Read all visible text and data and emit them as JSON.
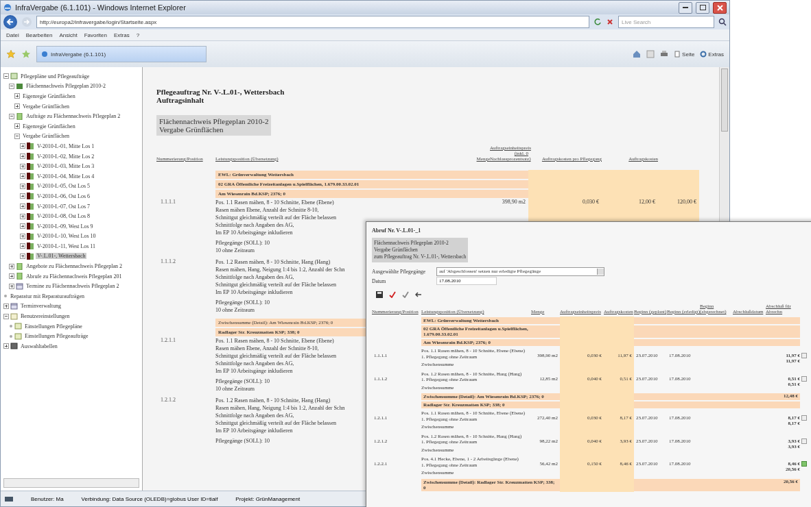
{
  "window": {
    "title": "InfraVergabe (6.1.101) - Windows Internet Explorer"
  },
  "address_bar": {
    "url": "http://europa2/infravergabe/login/Startseite.aspx",
    "search_placeholder": "Live Search"
  },
  "menu": [
    "Datei",
    "Bearbeiten",
    "Ansicht",
    "Favoriten",
    "Extras",
    "?"
  ],
  "tab": {
    "label": "InfraVergabe (6.1.101)",
    "selected": true
  },
  "command_bar": [
    "Seite",
    "Extras"
  ],
  "tree": [
    {
      "label": "Pflegepläne und Pflegeaufträge",
      "kind": "folder",
      "expanded": true,
      "children": [
        {
          "label": "Flächennachweis Pflegeplan 2010-2",
          "kind": "plan",
          "expanded": true,
          "children": [
            {
              "label": "Eigenregie Grünflächen",
              "expanded": false
            },
            {
              "label": "Vergabe Grünflächen",
              "expanded": false
            }
          ]
        },
        {
          "label": "Aufträge zu Flächennachweis Pflegeplan 2",
          "kind": "doc",
          "expanded": true,
          "children": [
            {
              "label": "Eigenregie Grünflächen",
              "expanded": false
            },
            {
              "label": "Vergabe Grünflächen",
              "expanded": true,
              "children": [
                {
                  "label": "V-2010-L-01, Mitte Los 1",
                  "kind": "lot",
                  "expanded": false,
                  "selected": false
                },
                {
                  "label": "V-2010-L-02, Mitte Los 2",
                  "kind": "lot",
                  "expanded": false,
                  "selected": false
                },
                {
                  "label": "V-2010-L-03, Mitte Los 3",
                  "kind": "lot",
                  "expanded": false,
                  "selected": false
                },
                {
                  "label": "V-2010-L-04, Mitte Los 4",
                  "kind": "lot",
                  "expanded": false,
                  "selected": false
                },
                {
                  "label": "V-2010-L-05, Ost Los 5",
                  "kind": "lot",
                  "expanded": false,
                  "selected": false
                },
                {
                  "label": "V-2010-L-06, Ost Los 6",
                  "kind": "lot",
                  "expanded": false,
                  "selected": false
                },
                {
                  "label": "V-2010-L-07, Ost Los 7",
                  "kind": "lot",
                  "expanded": false,
                  "selected": false
                },
                {
                  "label": "V-2010-L-08, Ost Los 8",
                  "kind": "lot",
                  "expanded": false,
                  "selected": false
                },
                {
                  "label": "V-2010-L-09, West Los 9",
                  "kind": "lot",
                  "expanded": false,
                  "selected": false
                },
                {
                  "label": "V-2010-L-10, West Los 10",
                  "kind": "lot",
                  "expanded": false,
                  "selected": false
                },
                {
                  "label": "V-2010-L-11, West Los 11",
                  "kind": "lot",
                  "expanded": false,
                  "selected": false
                },
                {
                  "label": "V-.L.01-, Wettersbach",
                  "kind": "lot",
                  "expanded": false,
                  "selected": true
                }
              ]
            }
          ]
        },
        {
          "label": "Angebote zu Flächennachweis Pflegeplan 2",
          "kind": "doc",
          "expanded": false
        },
        {
          "label": "Abrufe zu Flächennachweis Pflegeplan 201",
          "kind": "doc",
          "expanded": false
        },
        {
          "label": "Termine zu Flächennachweis Pflegeplan 2",
          "kind": "calendar",
          "expanded": false
        }
      ]
    },
    {
      "label": "Reparatur mit Reparaturaufträgen",
      "kind": "leaf"
    },
    {
      "label": "Terminverwaltung",
      "kind": "calendar",
      "expanded": false
    },
    {
      "label": "Benutzereinstellungen",
      "kind": "plain-folder",
      "expanded": true,
      "children": [
        {
          "label": "Einstellungen Pflegepläne",
          "kind": "settings"
        },
        {
          "label": "Einstellungen Pflegeaufträge",
          "kind": "settings"
        }
      ]
    },
    {
      "label": "Auswahltabellen",
      "kind": "table",
      "expanded": false
    }
  ],
  "content": {
    "title": "Pflegeauftrag Nr. V-.L.01-, Wettersbach",
    "subtitle": "Auftragsinhalt",
    "info": [
      "Flächennachweis Pflegeplan 2010-2",
      "Vergabe Grünflächen"
    ],
    "columns": [
      "Nummerierung/Position",
      "Leistungsposition (Übersetzung)",
      "Menge",
      "Auftragseinheitspreis (inkl. 0 Nachlassprozentsatz)",
      "Auftragskosten pro Pflegegang",
      "Auftragskosten"
    ],
    "rows": [
      {
        "kind": "group",
        "text": "EWL: Grünverwaltung Wettersbach"
      },
      {
        "kind": "group",
        "text": "02 GRA Öffentliche Freizeitanlagen u.Spielflächen, 1.679.00.33.02.01"
      },
      {
        "kind": "group",
        "text": "Am Wiesenrain Bd.KSP; 2376; 0"
      },
      {
        "kind": "item",
        "number": "1.1.1.1",
        "lines": [
          "Pos. 1.1 Rasen mähen, 8 - 10 Schnitte, Ebene (Ebene)",
          "Rasen mähen Ebene, Anzahl der Schnitte 8-10,",
          "Schnittgut gleichmäßig verteilt auf der Fläche belassen",
          "Schnittfolge nach Angaben des AG,",
          "Im EP 10 Arbeitsgänge inkludieren"
        ],
        "notes": [
          "Pflegegänge (SOLL): 10",
          "10 ohne Zeitraum"
        ],
        "quantity": "398,90  m2",
        "unit_price": "0,030 €",
        "per_visit": "12,00 €",
        "total": "120,00 €"
      },
      {
        "kind": "item",
        "number": "1.1.1.2",
        "lines": [
          "Pos. 1.2 Rasen mähen, 8 - 10 Schnitte, Hang (Hang)",
          "Rasen mähen, Hang, Neigung 1:4 bis 1:2, Anzahl der Schn",
          "Schnittfolge nach Angaben des AG,",
          "Schnittgut gleichmäßig verteilt auf der Fläche belassen",
          "Im EP 10 Arbeitsgänge inkludieren"
        ],
        "notes": [
          "Pflegegänge (SOLL): 10",
          "10 ohne Zeitraum"
        ]
      },
      {
        "kind": "subtotal",
        "text": "Zwischensumme (Detail): Am Wiesenrain Bd.KSP; 2376; 0"
      },
      {
        "kind": "group",
        "text": "Radlager Str. Kreuzmatten KSP; 338; 0"
      },
      {
        "kind": "item",
        "number": "1.2.1.1",
        "lines": [
          "Pos. 1.1 Rasen mähen, 8 - 10 Schnitte, Ebene (Ebene)",
          "Rasen mähen Ebene, Anzahl der Schnitte 8-10,",
          "Schnittgut gleichmäßig verteilt auf der Fläche belassen",
          "Schnittfolge nach Angaben des AG,",
          "Im EP 10 Arbeitsgänge inkludieren"
        ],
        "notes": [
          "Pflegegänge (SOLL): 10",
          "10 ohne Zeitraum"
        ]
      },
      {
        "kind": "item",
        "number": "1.2.1.2",
        "lines": [
          "Pos. 1.2 Rasen mähen, 8 - 10 Schnitte, Hang (Hang)",
          "Rasen mähen, Hang, Neigung 1:4 bis 1:2, Anzahl der Schn",
          "Schnittfolge nach Angaben des AG,",
          "Schnittgut gleichmäßig verteilt auf der Fläche belassen",
          "Im EP 10 Arbeitsgänge inkludieren"
        ],
        "notes": [
          "Pflegegänge (SOLL): 10"
        ]
      }
    ]
  },
  "status_bar": [
    "Benutzer: Ma",
    "Verbindung: Data Source (OLEDB)=globus User ID=tiaif",
    "Projekt: GrünManagement"
  ],
  "popup": {
    "title": "Abruf Nr. V-.L.01-_1",
    "info": [
      "Flächennachweis Pflegeplan 2010-2",
      "Vergabe Grünflächen",
      "zum Pflegeauftrag Nr. V-.L.01-, Wettersbach"
    ],
    "select_label": "Ausgewählte Pflegegänge",
    "select_value": "auf 'Abgeschlossen' setzen nur erledigte Pflegegänge",
    "date_label": "Datum",
    "date_value": "17.08.2010",
    "columns": [
      "Nummerierung/Position",
      "Leistungsposition (Übersetzung)",
      "Menge",
      "Auftragseinheitspreis",
      "Auftragskosten",
      "Beginn (geplant)",
      "Beginn (erledigt)",
      "Beginn (abgerechnet)",
      "Abschlußdatum",
      "Abschluß für Abrechn"
    ],
    "rows": [
      {
        "kind": "group",
        "text": "EWL: Grünverwaltung Wettersbach"
      },
      {
        "kind": "group",
        "text": "02 GRA Öffentliche Freizeitanlagen u.Spielflächen, 1.679.00.33.02.01"
      },
      {
        "kind": "group",
        "text": "Am Wiesenrain Bd.KSP; 2376; 0"
      },
      {
        "kind": "item",
        "number": "1.1.1.1",
        "lines": [
          "Pos. 1.1 Rasen mähen, 8 - 10 Schnitte, Ebene (Ebene)",
          "1. Pflegegang ohne Zeitraum"
        ],
        "note": "Zwischensumme",
        "quantity": "398,90  m2",
        "unit_price": "0,030 €",
        "cost": "11,97 €",
        "planned": "23.07.2010",
        "done": "17.08.2010",
        "amount": "11,97 €",
        "sum": "11,97 €",
        "checked": false
      },
      {
        "kind": "item",
        "number": "1.1.1.2",
        "lines": [
          "Pos. 1.2 Rasen mähen, 8 - 10 Schnitte, Hang (Hang)",
          "1. Pflegegang ohne Zeitraum"
        ],
        "note": "Zwischensumme",
        "quantity": "12,85  m2",
        "unit_price": "0,040 €",
        "cost": "0,51 €",
        "planned": "23.07.2010",
        "done": "17.08.2010",
        "amount": "0,51 €",
        "sum": "0,51 €",
        "checked": false
      },
      {
        "kind": "subtotal",
        "text": "Zwischensumme (Detail): Am Wiesenrain Bd.KSP; 2376; 0",
        "sum": "12,48 €"
      },
      {
        "kind": "group",
        "text": "Radlager Str. Kreuzmatten KSP; 338; 0"
      },
      {
        "kind": "item",
        "number": "1.2.1.1",
        "lines": [
          "Pos. 1.1 Rasen mähen, 8 - 10 Schnitte, Ebene (Ebene)",
          "1. Pflegegang ohne Zeitraum"
        ],
        "note": "Zwischensumme",
        "quantity": "272,40  m2",
        "unit_price": "0,030 €",
        "cost": "8,17 €",
        "planned": "23.07.2010",
        "done": "17.08.2010",
        "amount": "8,17 €",
        "sum": "8,17 €",
        "checked": false
      },
      {
        "kind": "item",
        "number": "1.2.1.2",
        "lines": [
          "Pos. 1.2 Rasen mähen, 8 - 10 Schnitte, Hang (Hang)",
          "1. Pflegegang ohne Zeitraum"
        ],
        "note": "Zwischensumme",
        "quantity": "98,22  m2",
        "unit_price": "0,040 €",
        "cost": "3,93 €",
        "planned": "23.07.2010",
        "done": "17.08.2010",
        "amount": "3,93 €",
        "sum": "3,93 €",
        "checked": false
      },
      {
        "kind": "item",
        "number": "1.2.2.1",
        "lines": [
          "Pos. 4.1 Hecke, Ebene, 1 - 2 Arbeitsgänge (Ebene)",
          "1. Pflegegang ohne Zeitraum"
        ],
        "note": "Zwischensumme",
        "quantity": "56,42  m2",
        "unit_price": "0,150 €",
        "cost": "8,46 €",
        "planned": "23.07.2010",
        "done": "17.08.2010",
        "amount": "8,46 €",
        "sum": "20,56 €",
        "checked": true
      },
      {
        "kind": "subtotal",
        "text": "Zwischensumme (Detail): Radlager Str. Kreuzmatten KSP; 338; 0",
        "sum": "20,56 €"
      }
    ]
  }
}
